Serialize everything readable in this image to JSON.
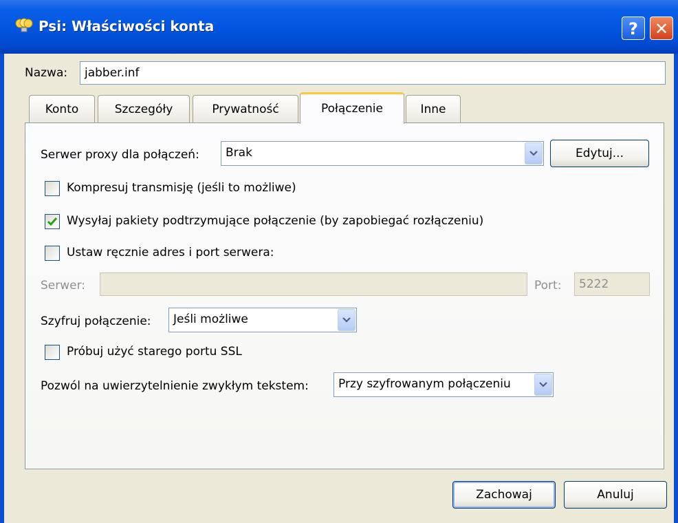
{
  "window": {
    "title": "Psi: Właściwości konta",
    "help_glyph": "?",
    "close_glyph": "✕"
  },
  "account": {
    "name_label": "Nazwa:",
    "name_value": "jabber.inf"
  },
  "tabs": [
    {
      "label": "Konto",
      "active": false
    },
    {
      "label": "Szczegóły",
      "active": false
    },
    {
      "label": "Prywatność",
      "active": false
    },
    {
      "label": "Połączenie",
      "active": true
    },
    {
      "label": "Inne",
      "active": false
    }
  ],
  "connection": {
    "proxy_label": "Serwer proxy dla połączeń:",
    "proxy_value": "Brak",
    "edit_button": "Edytuj...",
    "compress_label": "Kompresuj transmisję (jeśli to możliwe)",
    "compress_checked": false,
    "keepalive_label": "Wysyłaj pakiety podtrzymujące połączenie (by zapobiegać rozłączeniu)",
    "keepalive_checked": true,
    "manual_host_label": "Ustaw ręcznie adres i port serwera:",
    "manual_host_checked": false,
    "server_label": "Serwer:",
    "server_value": "",
    "port_label": "Port:",
    "port_value": "5222",
    "encrypt_label": "Szyfruj połączenie:",
    "encrypt_value": "Jeśli możliwe",
    "legacy_ssl_label": "Próbuj użyć starego portu SSL",
    "legacy_ssl_checked": false,
    "plaintext_auth_label": "Pozwól na uwierzytelnienie zwykłym tekstem:",
    "plaintext_auth_value": "Przy szyfrowanym połączeniu"
  },
  "footer": {
    "save_button": "Zachowaj",
    "cancel_button": "Anuluj"
  },
  "colors": {
    "titlebar": "#0255e0",
    "face": "#ece9d8",
    "tab_highlight": "#ffc83c",
    "checkmark": "#21a121"
  }
}
